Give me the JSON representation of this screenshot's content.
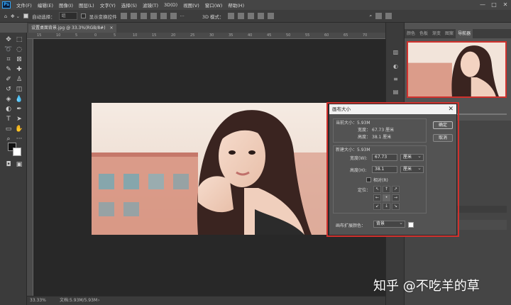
{
  "app": {
    "logo": "Ps"
  },
  "menu": [
    "文件(F)",
    "编辑(E)",
    "图像(I)",
    "图层(L)",
    "文字(Y)",
    "选择(S)",
    "滤镜(T)",
    "3D(D)",
    "视图(V)",
    "窗口(W)",
    "帮助(H)"
  ],
  "window_controls": [
    "—",
    "□",
    "✕"
  ],
  "options_bar": {
    "auto_select_label": "自动选择：",
    "auto_select_value": "组",
    "transform_label": "显示变换控件",
    "mode_label": "3D 模式："
  },
  "document": {
    "tab_label": "设置桌面背景.jpg @ 33.3%(RGB/8#)",
    "tab_close": "×",
    "ruler_ticks": [
      "15",
      "10",
      "5",
      "0",
      "5",
      "10",
      "15",
      "20",
      "25",
      "30",
      "35",
      "40",
      "45",
      "50",
      "55",
      "60",
      "65",
      "70"
    ],
    "status_zoom": "33.33%",
    "status_doc": "文档:5.93M/5.93M"
  },
  "panel": {
    "tabs": [
      "颜色",
      "色板",
      "渐变",
      "图案",
      "导航器"
    ],
    "active_tab": "导航器"
  },
  "dialog": {
    "title": "画布大小",
    "close": "✕",
    "current_size_label": "当前大小：5.93M",
    "current_width_label": "宽度：",
    "current_width_value": "67.73 厘米",
    "current_height_label": "高度：",
    "current_height_value": "38.1 厘米",
    "new_size_label": "新建大小：5.93M",
    "width_label": "宽度(W):",
    "width_value": "67.73",
    "width_unit": "厘米",
    "height_label": "高度(H):",
    "height_value": "38.1",
    "height_unit": "厘米",
    "relative_label": "相对(R)",
    "anchor_label": "定位：",
    "anchor_arrows": [
      "↖",
      "↑",
      "↗",
      "←",
      "•",
      "→",
      "↙",
      "↓",
      "↘"
    ],
    "ext_color_label": "画布扩展颜色：",
    "ext_color_value": "背景",
    "ok_label": "确定",
    "cancel_label": "取消"
  },
  "watermark": "知乎 @不吃羊的草",
  "colors": {
    "highlight": "#d0312d",
    "foreground": "#111111",
    "background": "#ffffff"
  }
}
